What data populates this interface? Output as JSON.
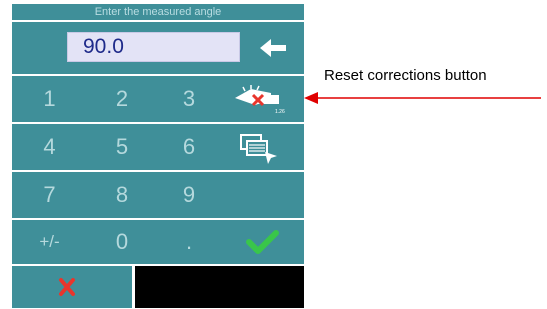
{
  "window": {
    "title": "Enter the measured angle"
  },
  "display": {
    "value": "90.0"
  },
  "keypad": {
    "row1": [
      "1",
      "2",
      "3"
    ],
    "row2": [
      "4",
      "5",
      "6"
    ],
    "row3": [
      "7",
      "8",
      "9"
    ],
    "row4": [
      "+/-",
      "0",
      "."
    ]
  },
  "icons": {
    "backspace": "backspace-arrow-icon",
    "reset": "reset-corrections-icon",
    "copy": "copy-corrections-icon",
    "confirm": "checkmark-icon",
    "cancel": "x-cancel-icon"
  },
  "annotation": {
    "label": "Reset corrections button"
  },
  "colors": {
    "panel": "#3f8f99",
    "key_text": "#b5d9dd",
    "display_bg": "#e3e3f6",
    "display_text": "#1e2a8a",
    "confirm": "#39c64a",
    "cancel": "#e8352c",
    "arrow": "#e00000"
  }
}
